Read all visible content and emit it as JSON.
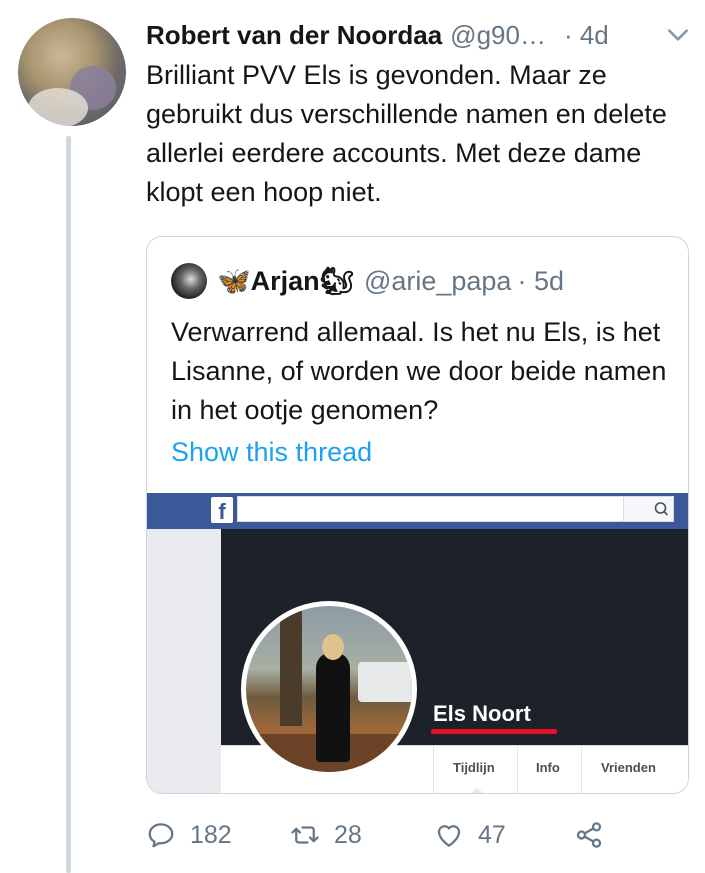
{
  "tweet": {
    "author_name": "Robert van der Noordaa",
    "author_handle": "@g90…",
    "time": "· 4d",
    "text": "Brilliant PVV Els is gevonden. Maar ze gebruikt dus verschillende namen en delete allerlei eerdere accounts. Met deze dame klopt een hoop niet."
  },
  "quoted": {
    "name_prefix_emoji": "🦋",
    "name": "Arjan",
    "name_suffix_emoji": "🐿",
    "handle": "@arie_papa",
    "time": "· 5d",
    "text": "Verwarrend allemaal. Is het nu Els, is het Lisanne, of worden we door beide namen in het ootje genomen?",
    "show_thread": "Show this thread"
  },
  "facebook_screenshot": {
    "logo": "f",
    "profile_name": "Els Noort",
    "tabs": [
      "Tijdlijn",
      "Info",
      "Vrienden"
    ]
  },
  "actions": {
    "reply_count": "182",
    "retweet_count": "28",
    "like_count": "47"
  },
  "colors": {
    "link": "#1da1f2",
    "secondary_text": "#657786",
    "facebook_blue": "#3b5998",
    "highlight_underline": "#e8102b"
  }
}
